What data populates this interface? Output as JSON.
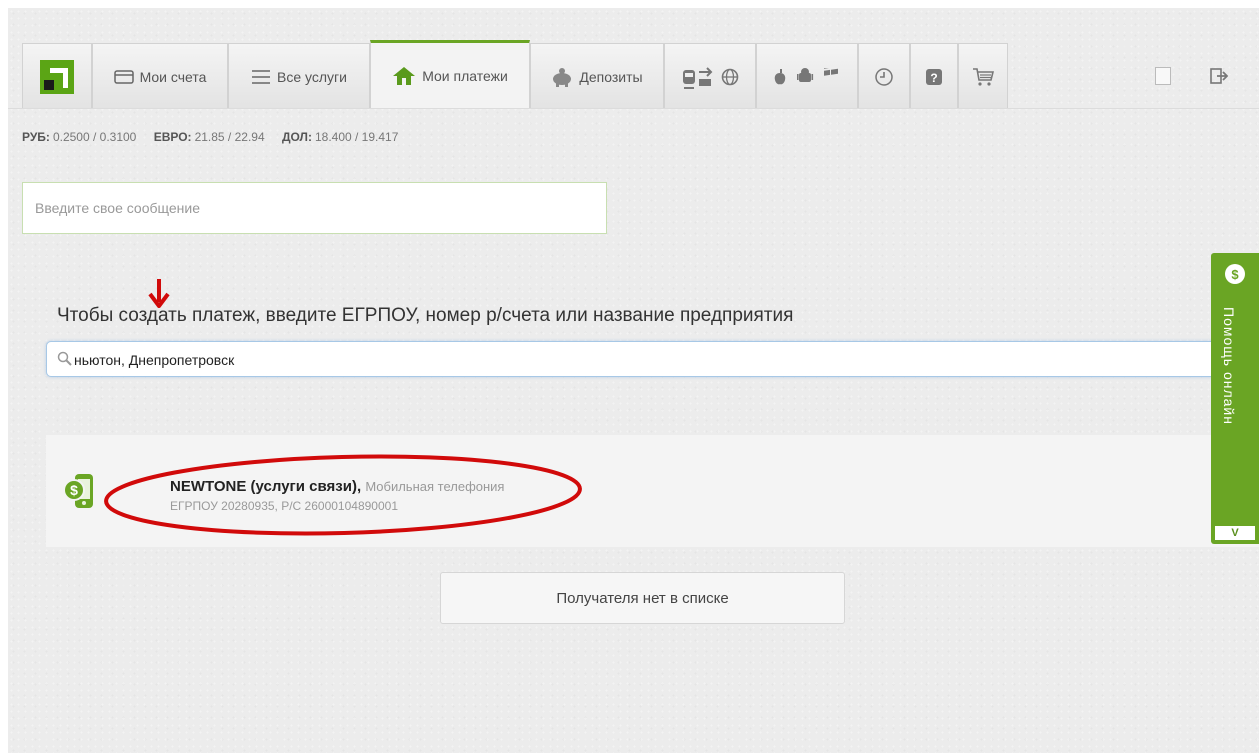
{
  "tabs": {
    "accounts": "Мои счета",
    "services": "Все услуги",
    "payments": "Мои платежи",
    "deposits": "Депозиты"
  },
  "rates": {
    "rub_label": "РУБ:",
    "rub_value": "0.2500 / 0.3100",
    "eur_label": "ЕВРО:",
    "eur_value": "21.85 / 22.94",
    "usd_label": "ДОЛ:",
    "usd_value": "18.400 / 19.417"
  },
  "message": {
    "placeholder": "Введите свое сообщение"
  },
  "instruction": "Чтобы создать платеж, введите ЕГРПОУ, номер р/счета или название предприятия",
  "search": {
    "value": "ньютон, Днепропетровск"
  },
  "result": {
    "name": "NEWTONE (услуги связи),",
    "category": "Мобильная телефония",
    "details": "ЕГРПОУ 20280935, Р/С 26000104890001"
  },
  "not_listed_button": "Получателя нет в списке",
  "help": {
    "label": "Помощь онлайн",
    "collapse": "V"
  },
  "colors": {
    "accent": "#6aa524",
    "annotation": "#d10a0a"
  }
}
